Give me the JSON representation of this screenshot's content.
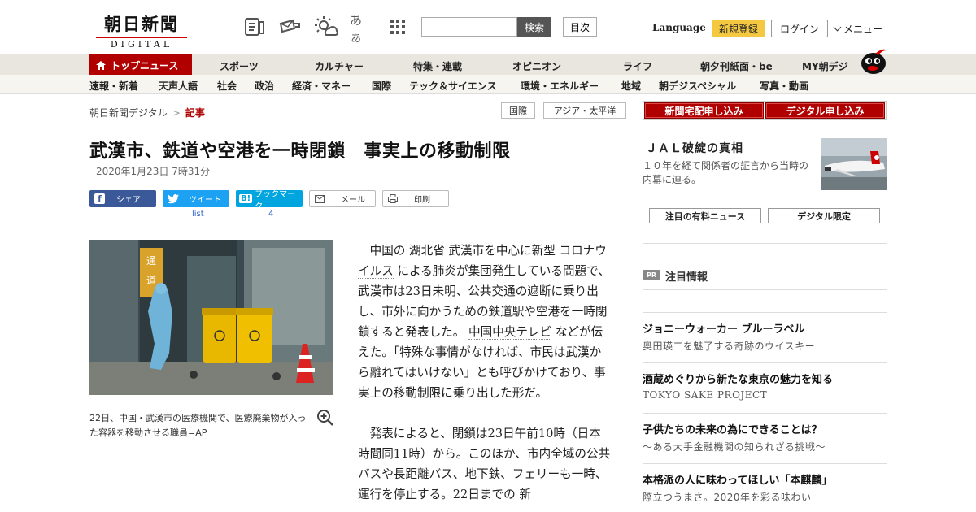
{
  "header": {
    "logo_main": "朝日新聞",
    "logo_sub": "DIGITAL",
    "icons": [
      "newspaper-icon",
      "mail-icon",
      "weather-icon",
      "font-size-icon",
      "apps-grid-icon"
    ],
    "font_icon_text": "あぁ",
    "search_placeholder": "",
    "search_button": "検索",
    "toc_button": "目次",
    "language": "Language",
    "signup": "新規登録",
    "login": "ログイン",
    "menu": "メニュー"
  },
  "nav_primary": [
    "トップニュース",
    "スポーツ",
    "カルチャー",
    "特集・連載",
    "オピニオン",
    "ライフ",
    "朝夕刊紙面・be",
    "MY朝デジ"
  ],
  "nav_secondary": [
    "速報・新着",
    "天声人語",
    "社会",
    "政治",
    "経済・マネー",
    "国際",
    "テック＆サイエンス",
    "環境・エネルギー",
    "地域",
    "朝デジスペシャル",
    "写真・動画"
  ],
  "breadcrumb": {
    "home": "朝日新聞デジタル",
    "current": "記事"
  },
  "tags": [
    "国際",
    "アジア・太平洋"
  ],
  "article": {
    "headline": "武漢市、鉄道や空港を一時閉鎖　事実上の移動制限",
    "date": "2020年1月23日 7時31分",
    "share": {
      "facebook": "シェア",
      "twitter": "ツイート",
      "twitter_count": "list",
      "hatena": "ブックマーク",
      "hatena_count": "4",
      "mail": "メール",
      "print": "印刷"
    },
    "photo_caption": "22日、中国・武漢市の医療機関で、医療廃棄物が入った容器を移動させる職員=AP",
    "p1": {
      "t1": "中国の",
      "k1": "湖北省",
      "t2": "武漢市を中心に新型",
      "k2": "コロナウイルス",
      "t3": "による肺炎が集団発生している問題で、武漢市は23日未明、公共交通の遮断に乗り出し、市外に向かうための鉄道駅や空港を一時閉鎖すると発表した。",
      "k3": "中国中央テレビ",
      "t4": "などが伝えた。「特殊な事情がなければ、市民は武漢から離れてはいけない」とも呼びかけており、事実上の移動制限に乗り出した形だ。"
    },
    "p2": "発表によると、閉鎖は23日午前10時（日本時間同11時）から。このほか、市内全域の公共バスや長距離バス、地下鉄、フェリーも一時、運行を停止する。22日までの 新"
  },
  "sidebar": {
    "subscribe_paper": "新聞宅配申し込み",
    "subscribe_digital": "デジタル申し込み",
    "promo_title": "ＪＡＬ破綻の真相",
    "promo_desc": "１０年を経て関係者の証言から当時の内幕に迫る。",
    "btn_paid_news": "注目の有料ニュース",
    "btn_digital_only": "デジタル限定",
    "pr_badge": "PR",
    "pr_heading": "注目情報",
    "ads": [
      {
        "title": "ジョニーウォーカー ブルーラベル",
        "sub": "奥田瑛二を魅了する奇跡のウイスキー"
      },
      {
        "title": "酒蔵めぐりから新たな東京の魅力を知る",
        "sub": "TOKYO SAKE PROJECT"
      },
      {
        "title": "子供たちの未来の為にできることは？",
        "sub": "～ある大手金融機関の知られざる挑戦～"
      },
      {
        "title": "本格派の人に味わってほしい「本麒麟」",
        "sub": "際立つうまさ。2020年を彩る味わい"
      }
    ]
  },
  "colors": {
    "brand_red": "#b00000",
    "signup_yellow": "#f5c842",
    "facebook": "#3b5998",
    "twitter": "#1da1f2",
    "hatena": "#00a4de"
  }
}
